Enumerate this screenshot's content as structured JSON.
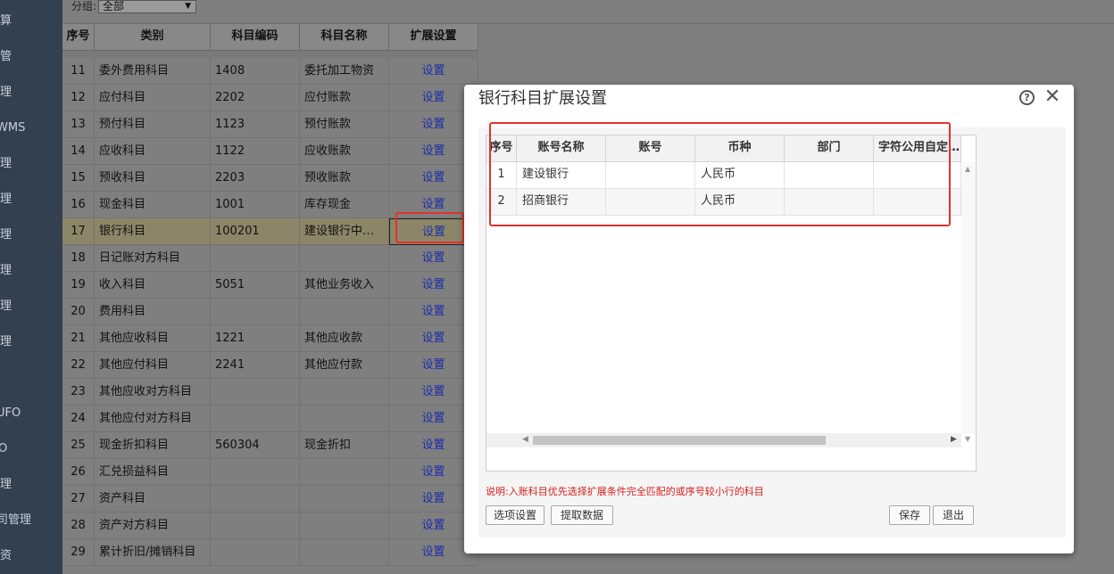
{
  "sidenav": {
    "items": [
      {
        "label": "核算"
      },
      {
        "label": "仓管"
      },
      {
        "label": "管理"
      },
      {
        "label": "WMS"
      },
      {
        "label": "管理"
      },
      {
        "label": "管理"
      },
      {
        "label": "管理"
      },
      {
        "label": "管理"
      },
      {
        "label": "管理"
      },
      {
        "label": "管理"
      },
      {
        "label": "UFO"
      },
      {
        "label": "O"
      },
      {
        "label": "管理"
      },
      {
        "label": "司管理"
      },
      {
        "label": "工资"
      }
    ]
  },
  "filter": {
    "label": "分组:",
    "value": "全部"
  },
  "grid": {
    "headers": {
      "seq": "序号",
      "category": "类别",
      "code": "科目编码",
      "name": "科目名称",
      "ext": "扩展设置"
    },
    "rows": [
      {
        "seq": "11",
        "category": "委外费用科目",
        "code": "1408",
        "name": "委托加工物资",
        "ext": "设置"
      },
      {
        "seq": "12",
        "category": "应付科目",
        "code": "2202",
        "name": "应付账款",
        "ext": "设置"
      },
      {
        "seq": "13",
        "category": "预付科目",
        "code": "1123",
        "name": "预付账款",
        "ext": "设置"
      },
      {
        "seq": "14",
        "category": "应收科目",
        "code": "1122",
        "name": "应收账款",
        "ext": "设置"
      },
      {
        "seq": "15",
        "category": "预收科目",
        "code": "2203",
        "name": "预收账款",
        "ext": "设置"
      },
      {
        "seq": "16",
        "category": "现金科目",
        "code": "1001",
        "name": "库存现金",
        "ext": "设置"
      },
      {
        "seq": "17",
        "category": "银行科目",
        "code": "100201",
        "name": "建设银行中…",
        "ext": "设置"
      },
      {
        "seq": "18",
        "category": "日记账对方科目",
        "code": "",
        "name": "",
        "ext": "设置"
      },
      {
        "seq": "19",
        "category": "收入科目",
        "code": "5051",
        "name": "其他业务收入",
        "ext": "设置"
      },
      {
        "seq": "20",
        "category": "费用科目",
        "code": "",
        "name": "",
        "ext": "设置"
      },
      {
        "seq": "21",
        "category": "其他应收科目",
        "code": "1221",
        "name": "其他应收款",
        "ext": "设置"
      },
      {
        "seq": "22",
        "category": "其他应付科目",
        "code": "2241",
        "name": "其他应付款",
        "ext": "设置"
      },
      {
        "seq": "23",
        "category": "其他应收对方科目",
        "code": "",
        "name": "",
        "ext": "设置"
      },
      {
        "seq": "24",
        "category": "其他应付对方科目",
        "code": "",
        "name": "",
        "ext": "设置"
      },
      {
        "seq": "25",
        "category": "现金折扣科目",
        "code": "560304",
        "name": "现金折扣",
        "ext": "设置"
      },
      {
        "seq": "26",
        "category": "汇兑损益科目",
        "code": "",
        "name": "",
        "ext": "设置"
      },
      {
        "seq": "27",
        "category": "资产科目",
        "code": "",
        "name": "",
        "ext": "设置"
      },
      {
        "seq": "28",
        "category": "资产对方科目",
        "code": "",
        "name": "",
        "ext": "设置"
      },
      {
        "seq": "29",
        "category": "累计折旧/摊销科目",
        "code": "",
        "name": "",
        "ext": "设置"
      }
    ]
  },
  "dialog": {
    "title": "银行科目扩展设置",
    "help_icon": "?",
    "close_icon": "✕",
    "table": {
      "headers": {
        "seq": "序号",
        "name": "账号名称",
        "account": "账号",
        "currency": "币种",
        "dept": "部门",
        "custom": "字符公用自定…"
      },
      "rows": [
        {
          "seq": "1",
          "name": "建设银行",
          "account": "",
          "currency": "人民币",
          "dept": "",
          "custom": ""
        },
        {
          "seq": "2",
          "name": "招商银行",
          "account": "",
          "currency": "人民币",
          "dept": "",
          "custom": ""
        }
      ]
    },
    "note": "说明:入账科目优先选择扩展条件完全匹配的或序号较小行的科目",
    "buttons": {
      "options": "选项设置",
      "fetch": "提取数据",
      "save": "保存",
      "exit": "退出"
    }
  },
  "colors": {
    "highlight": "#e8302a",
    "link": "#1d2fa8",
    "note": "#d42020",
    "nav_bg": "#33404f"
  }
}
